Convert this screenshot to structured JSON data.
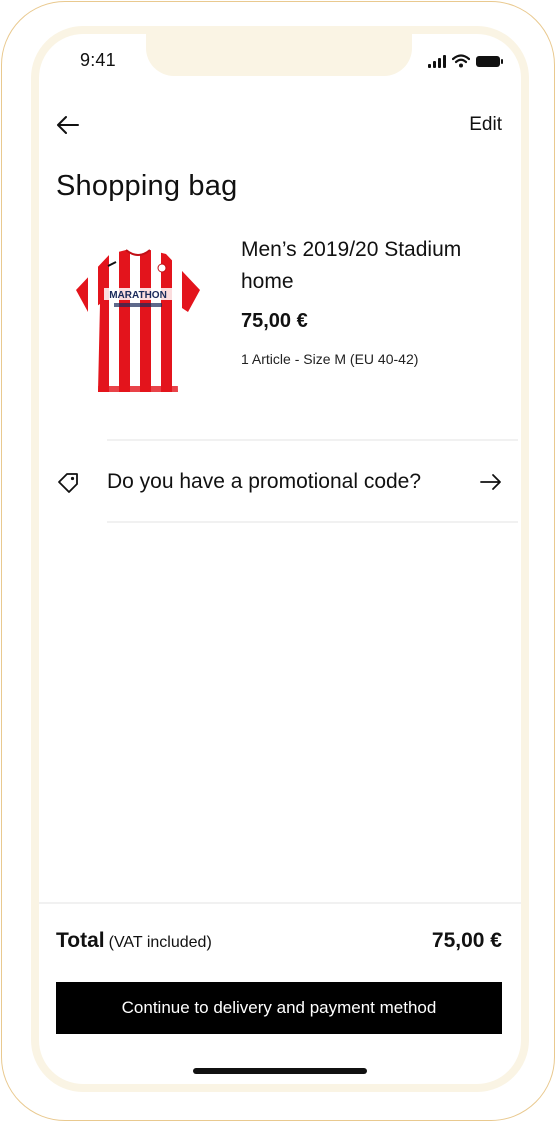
{
  "status_bar": {
    "time": "9:41",
    "icons": [
      "signal-icon",
      "wifi-icon",
      "battery-icon"
    ]
  },
  "header": {
    "back_icon": "back-arrow-icon",
    "edit_label": "Edit"
  },
  "page": {
    "title": "Shopping bag"
  },
  "cart_item": {
    "name": "Men’s 2019/20 Stadium home",
    "price": "75,00 €",
    "details": "1 Article - Size M (EU 40-42)",
    "image_icon": "football-jersey-image",
    "jersey_sponsor": "MARATHON"
  },
  "promo": {
    "icon": "tag-icon",
    "label": "Do you have a promotional code?",
    "arrow_icon": "arrow-right-icon"
  },
  "summary": {
    "total_label": "Total",
    "vat_note": "(VAT included)",
    "total_value": "75,00 €"
  },
  "cta": {
    "label": "Continue to delivery and payment method"
  },
  "colors": {
    "frame_border": "#e9c98f",
    "bezel": "#faf4e4",
    "jersey_red": "#e3141c",
    "button_bg": "#000000"
  }
}
